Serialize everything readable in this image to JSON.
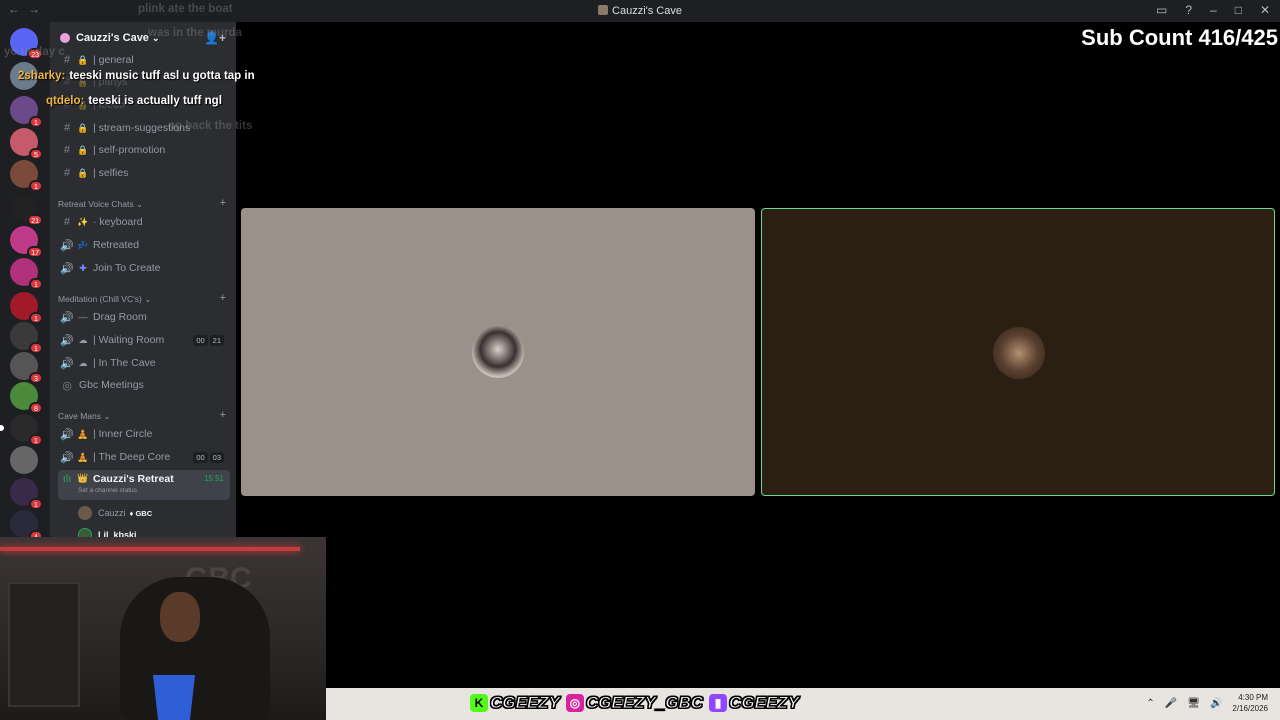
{
  "window": {
    "title": "Cauzzi's Cave"
  },
  "rail": {
    "servers": [
      {
        "badge": "23"
      },
      {
        "badge": ""
      },
      {
        "badge": "1"
      },
      {
        "badge": "5"
      },
      {
        "badge": "1"
      },
      {
        "badge": "21"
      },
      {
        "badge": "17"
      },
      {
        "badge": "1"
      },
      {
        "badge": "1"
      },
      {
        "badge": "1"
      },
      {
        "badge": "3"
      },
      {
        "badge": "8"
      },
      {
        "badge": "1"
      },
      {
        "badge": ""
      },
      {
        "badge": "1"
      },
      {
        "badge": "4"
      }
    ]
  },
  "server": {
    "name": "Cauzzi's Cave",
    "channels_top": [
      {
        "name": "| general"
      },
      {
        "name": "| partys"
      },
      {
        "name": "| feedb"
      },
      {
        "name": "| stream-suggestions"
      },
      {
        "name": "| self-promotion"
      },
      {
        "name": "| selfies"
      }
    ],
    "cat_retreat": "Retreat Voice Chats",
    "retreat": [
      {
        "name": "· keyboard"
      },
      {
        "name": "Retreated"
      },
      {
        "name": "Join To Create"
      }
    ],
    "cat_meditation": "Meditation (Chill VC's)",
    "meditation": [
      {
        "name": "Drag Room"
      },
      {
        "name": "| Waiting Room",
        "c1": "00",
        "c2": "21"
      },
      {
        "name": "| In The Cave"
      },
      {
        "name": "Gbc Meetings"
      }
    ],
    "cat_cave": "Cave Mans",
    "cave": [
      {
        "name": "| Inner Circle"
      },
      {
        "name": "| The Deep Core",
        "c1": "00",
        "c2": "03"
      }
    ],
    "active": {
      "name": "Cauzzi's Retreat",
      "timer": "15:51",
      "status": "Set a channel status"
    },
    "users": [
      {
        "name": "Cauzzi",
        "tag": "GBC"
      },
      {
        "name": "Lil_kbski"
      }
    ]
  },
  "chat": {
    "faded": [
      "plink ate the boat",
      "was in the murda",
      "yo ur day c",
      "ng back the tits"
    ],
    "lines": [
      {
        "user": "2sharky:",
        "msg": "teeski music tuff asl u gotta tap in",
        "color": "#f0b542"
      },
      {
        "user": "qtdelo:",
        "msg": "teeski is actually tuff ngl",
        "color": "#f0b542"
      }
    ]
  },
  "overlay": {
    "subcount": "Sub Count 416/425"
  },
  "socials": [
    {
      "icon": "K",
      "handle": "CGEEZY",
      "color": "#53fc18"
    },
    {
      "icon": "◎",
      "handle": "CGEEZY_GBC",
      "color": "#d6249f"
    },
    {
      "icon": "▮",
      "handle": "CGEEZY",
      "color": "#9146ff"
    }
  ],
  "taskbar": {
    "time": "4:30 PM",
    "date": "2/16/2026"
  }
}
